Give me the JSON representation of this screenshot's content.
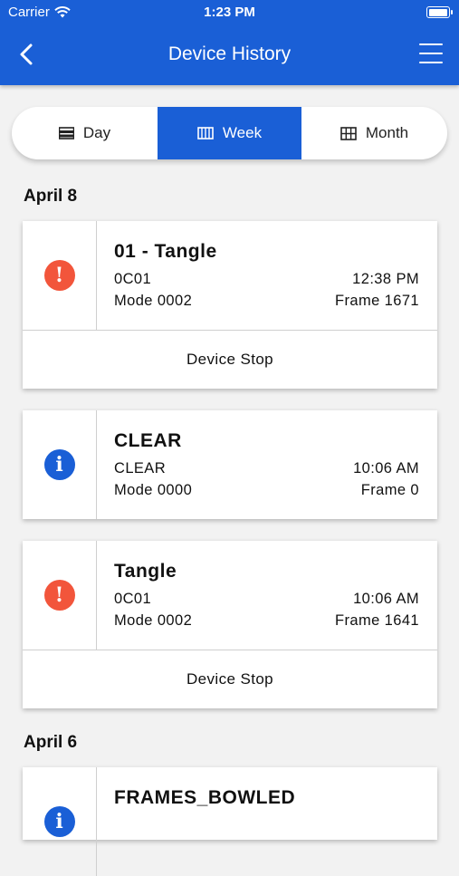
{
  "status_bar": {
    "carrier": "Carrier",
    "time": "1:23 PM"
  },
  "header": {
    "title": "Device History"
  },
  "segments": [
    {
      "label": "Day",
      "icon": "day-icon",
      "active": false
    },
    {
      "label": "Week",
      "icon": "week-icon",
      "active": true
    },
    {
      "label": "Month",
      "icon": "month-icon",
      "active": false
    }
  ],
  "groups": [
    {
      "date": "April 8",
      "events": [
        {
          "type": "alert",
          "title": "01 - Tangle",
          "code": "0C01",
          "time": "12:38 PM",
          "mode": "Mode 0002",
          "frame": "Frame 1671",
          "action": "Device Stop"
        },
        {
          "type": "info",
          "title": "CLEAR",
          "code": "CLEAR",
          "time": "10:06 AM",
          "mode": "Mode 0000",
          "frame": "Frame 0",
          "action": null
        },
        {
          "type": "alert",
          "title": "Tangle",
          "code": "0C01",
          "time": "10:06 AM",
          "mode": "Mode 0002",
          "frame": "Frame 1641",
          "action": "Device Stop"
        }
      ]
    },
    {
      "date": "April 6",
      "events": [
        {
          "type": "info",
          "title": "FRAMES_BOWLED"
        }
      ]
    }
  ],
  "colors": {
    "primary": "#1a5fd6",
    "alert": "#f2553b",
    "background": "#f2f2f2"
  }
}
